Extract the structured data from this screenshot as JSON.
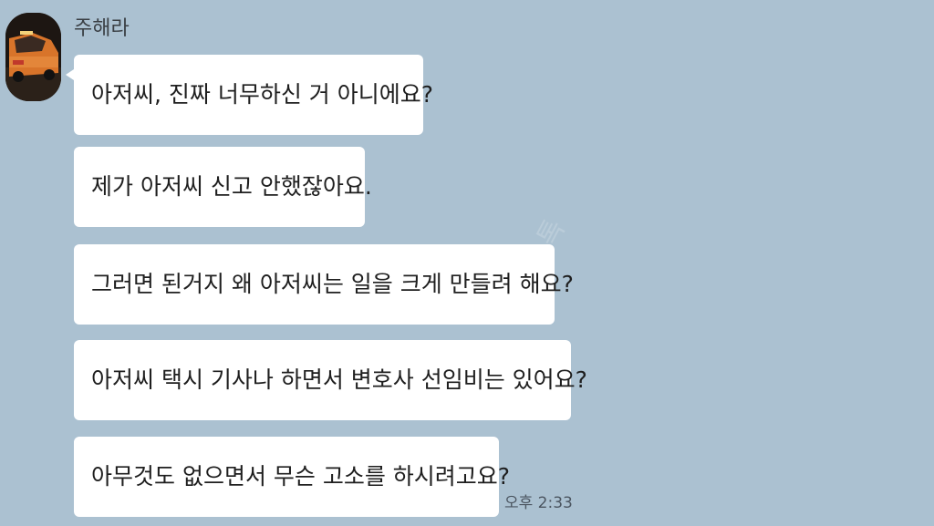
{
  "chat": {
    "sender_name": "주해라",
    "avatar_icon": "taxi-photo-avatar",
    "watermark": "톡",
    "messages": [
      {
        "text": "아저씨, 진짜 너무하신 거 아니에요?"
      },
      {
        "text": "제가 아저씨 신고 안했잖아요."
      },
      {
        "text": "그러면 된거지 왜 아저씨는 일을 크게 만들려 해요?"
      },
      {
        "text": "아저씨 택시 기사나 하면서 변호사 선임비는 있어요?"
      },
      {
        "text": "아무것도 없으면서 무슨 고소를 하시려고요?"
      }
    ],
    "timestamp": "오후 2:33"
  },
  "colors": {
    "background": "#abc1d1",
    "bubble": "#ffffff",
    "text": "#1e1e1e"
  }
}
